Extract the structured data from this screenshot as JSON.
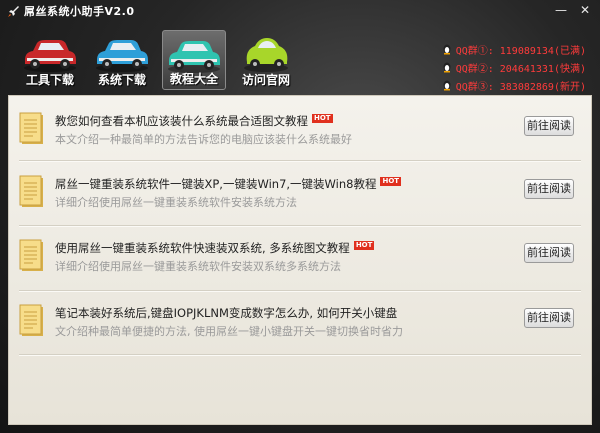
{
  "window": {
    "title": "屌丝系统小助手V2.0",
    "controls": [
      "—",
      "✕"
    ]
  },
  "nav": [
    {
      "label": "工具下载",
      "car_color": "#c8282a",
      "active": false
    },
    {
      "label": "系统下载",
      "car_color": "#2f9fd8",
      "active": false
    },
    {
      "label": "教程大全",
      "car_color": "#2fc4b0",
      "active": true
    },
    {
      "label": "访问官网",
      "car_color": "#a8d62a",
      "active": false
    }
  ],
  "qq_groups": [
    {
      "text": "QQ群①: 119089134(已满)"
    },
    {
      "text": "QQ群②: 204641331(快满)"
    },
    {
      "text": "QQ群③: 383082869(新开)"
    }
  ],
  "articles": [
    {
      "title": "教您如何查看本机应该装什么系统最合适图文教程",
      "desc": "本文介绍一种最简单的方法告诉您的电脑应该装什么系统最好",
      "badge": "HOT",
      "button": "前往阅读"
    },
    {
      "title": "屌丝一键重装系统软件一键装XP,一键装Win7,一键装Win8教程",
      "desc": "详细介绍使用屌丝一键重装系统软件安装系统方法",
      "badge": "HOT",
      "button": "前往阅读"
    },
    {
      "title": "使用屌丝一键重装系统软件快速装双系统, 多系统图文教程",
      "desc": "详细介绍使用屌丝一键重装系统软件安装双系统多系统方法",
      "badge": "HOT",
      "button": "前往阅读"
    },
    {
      "title": "笔记本装好系统后,键盘IOPJKLNM变成数字怎么办, 如何开关小键盘",
      "desc": "文介绍种最简单便捷的方法, 使用屌丝一键小键盘开关一键切换省时省力",
      "badge": "",
      "button": "前往阅读"
    }
  ]
}
